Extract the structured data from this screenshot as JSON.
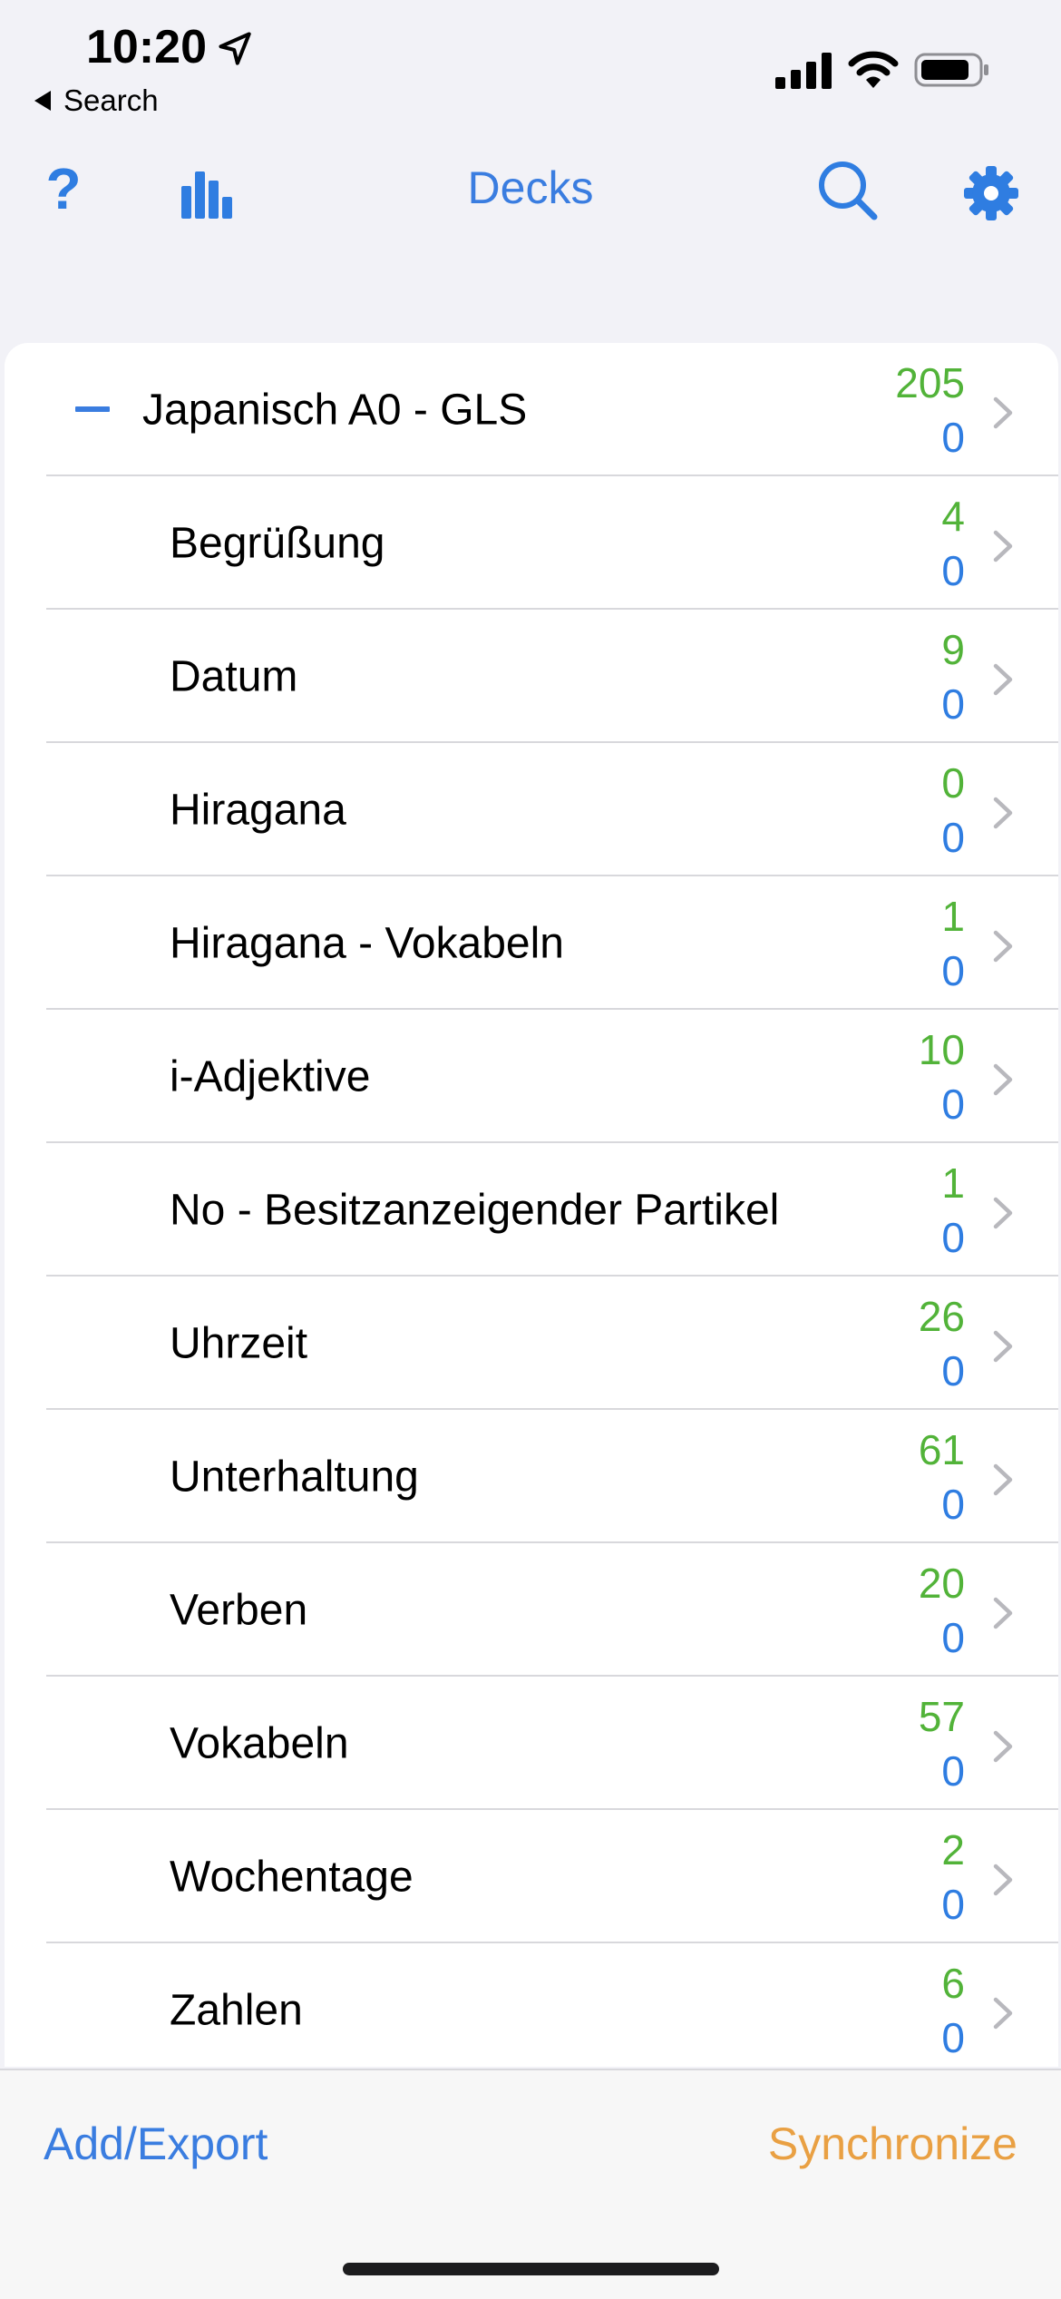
{
  "status_bar": {
    "time": "10:20",
    "back_label": "Search"
  },
  "toolbar": {
    "help_label": "?",
    "title": "Decks"
  },
  "decks": [
    {
      "name": "Japanisch A0 - GLS",
      "new": "205",
      "due": "0"
    },
    {
      "name": "Begrüßung",
      "new": "4",
      "due": "0"
    },
    {
      "name": "Datum",
      "new": "9",
      "due": "0"
    },
    {
      "name": "Hiragana",
      "new": "0",
      "due": "0"
    },
    {
      "name": "Hiragana - Vokabeln",
      "new": "1",
      "due": "0"
    },
    {
      "name": "i-Adjektive",
      "new": "10",
      "due": "0"
    },
    {
      "name": "No - Besitzanzeigender Partikel",
      "new": "1",
      "due": "0"
    },
    {
      "name": "Uhrzeit",
      "new": "26",
      "due": "0"
    },
    {
      "name": "Unterhaltung",
      "new": "61",
      "due": "0"
    },
    {
      "name": "Verben",
      "new": "20",
      "due": "0"
    },
    {
      "name": "Vokabeln",
      "new": "57",
      "due": "0"
    },
    {
      "name": "Wochentage",
      "new": "2",
      "due": "0"
    },
    {
      "name": "Zahlen",
      "new": "6",
      "due": "0"
    }
  ],
  "bottom_bar": {
    "add_export_label": "Add/Export",
    "sync_label": "Synchronize"
  },
  "colors": {
    "accent": "#3a7de0",
    "new_count": "#52b339",
    "due_count": "#2f7de1",
    "sync": "#e9a043",
    "background": "#f2f2f7"
  },
  "icons": [
    "location-arrow-icon",
    "signal-icon",
    "wifi-icon",
    "battery-icon",
    "help-icon",
    "bar-chart-icon",
    "search-icon",
    "gear-icon",
    "minus-icon",
    "chevron-right-icon"
  ]
}
